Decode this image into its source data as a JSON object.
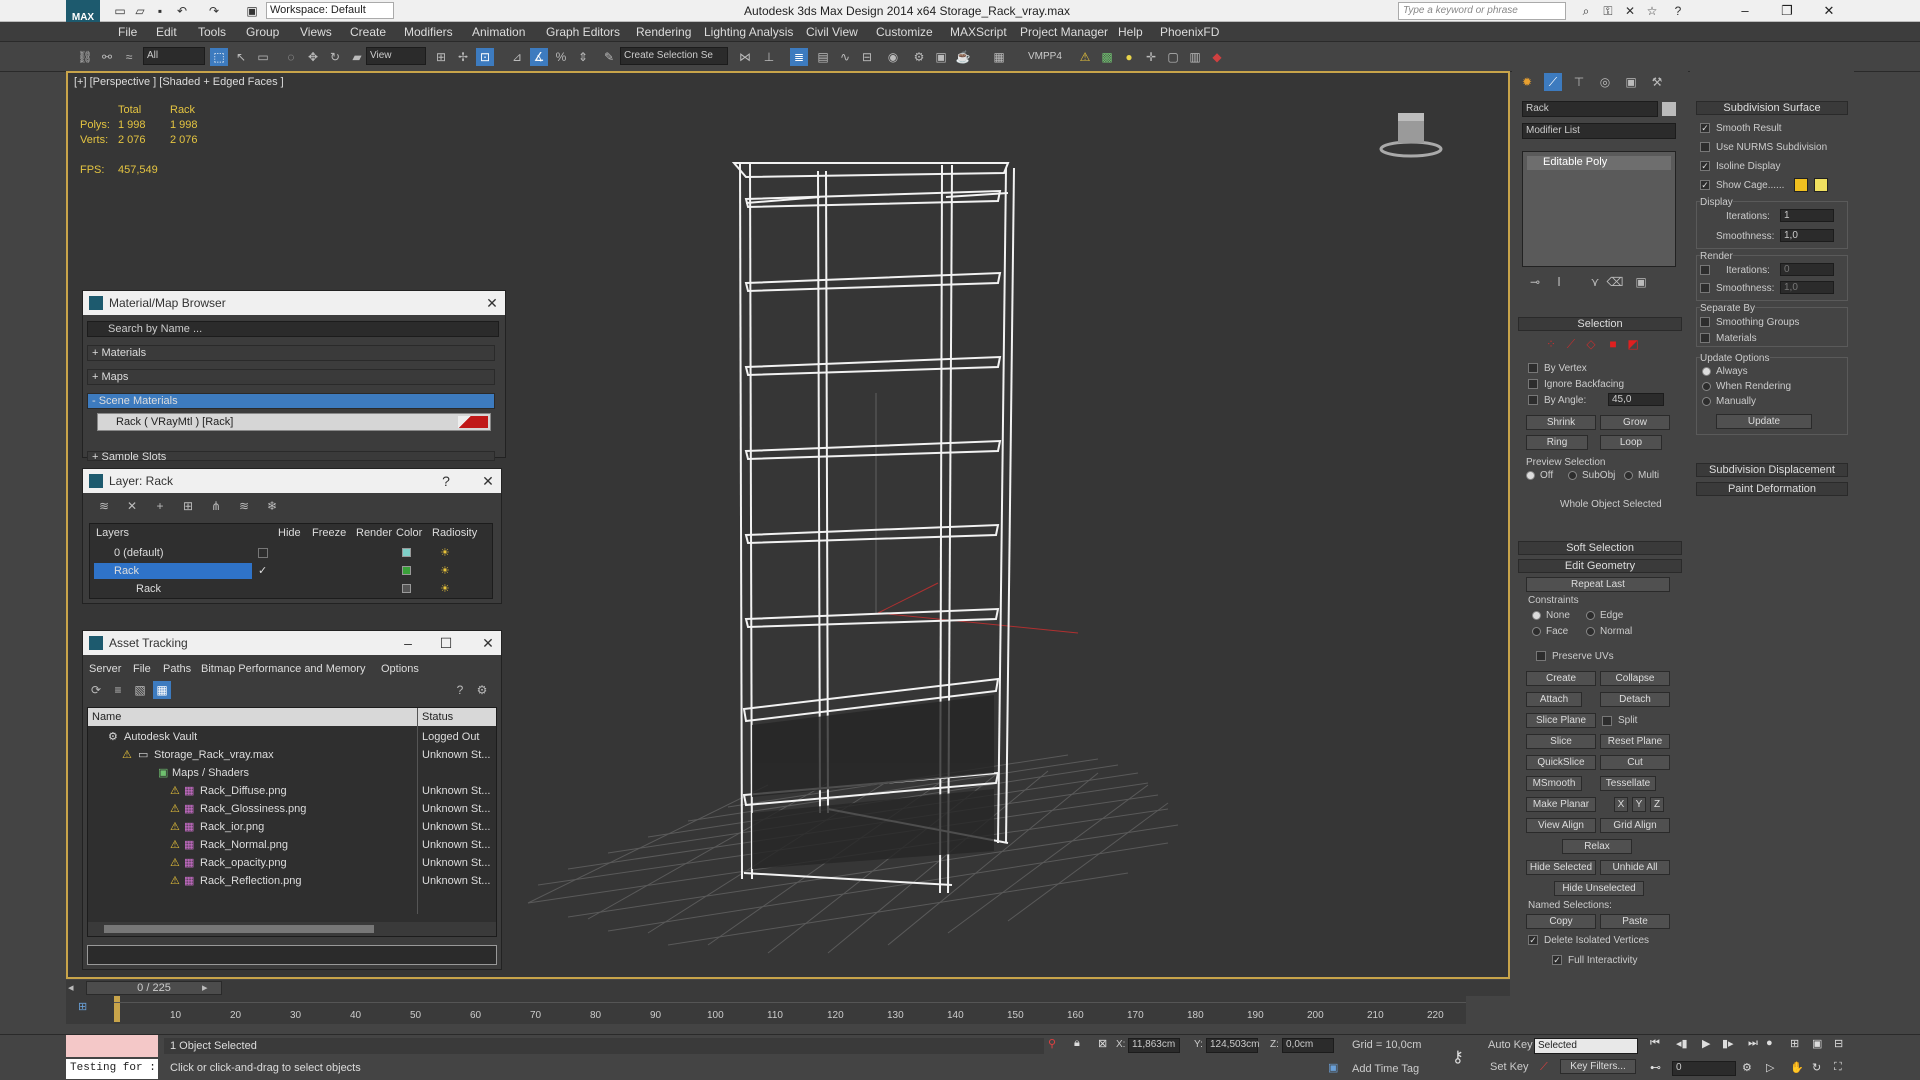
{
  "titlebar": {
    "workspace": "Workspace: Default",
    "title": "Autodesk 3ds Max Design 2014 x64     Storage_Rack_vray.max",
    "search_placeholder": "Type a keyword or phrase",
    "logo": "MAX"
  },
  "menu": [
    "File",
    "Edit",
    "Tools",
    "Group",
    "Views",
    "Create",
    "Modifiers",
    "Animation",
    "Graph Editors",
    "Rendering",
    "Lighting Analysis",
    "Civil View",
    "Customize",
    "MAXScript",
    "Project Manager",
    "Help",
    "PhoenixFD"
  ],
  "toolbar": {
    "filter": "All",
    "refcoord": "View",
    "selection_set": "Create Selection Se",
    "vmpp": "VMPP4"
  },
  "viewport": {
    "label": "[+] [Perspective ] [Shaded + Edged Faces ]",
    "stats": {
      "col_total": "Total",
      "col_rack": "Rack",
      "polys_label": "Polys:",
      "polys_total": "1 998",
      "polys_rack": "1 998",
      "verts_label": "Verts:",
      "verts_total": "2 076",
      "verts_rack": "2 076",
      "fps_label": "FPS:",
      "fps_value": "457,549"
    }
  },
  "material_browser": {
    "title": "Material/Map Browser",
    "search": "Search by Name ...",
    "rollouts": [
      "+ Materials",
      "+ Maps",
      "- Scene Materials"
    ],
    "item": "Rack  ( VRayMtl )  [Rack]",
    "sample_slots": "+ Sample Slots"
  },
  "layer": {
    "title": "Layer: Rack",
    "help": "?",
    "columns": [
      "Layers",
      "Hide",
      "Freeze",
      "Render",
      "Color",
      "Radiosity"
    ],
    "rows": [
      {
        "name": "0 (default)",
        "color": "#7fd0c8"
      },
      {
        "name": "Rack",
        "color": "#3aa03a"
      },
      {
        "name": "Rack",
        "color": "#555555"
      }
    ]
  },
  "asset": {
    "title": "Asset Tracking",
    "menu": [
      "Server",
      "File",
      "Paths",
      "Bitmap Performance and Memory",
      "Options"
    ],
    "columns": [
      "Name",
      "Status"
    ],
    "rows": [
      {
        "name": "Autodesk Vault",
        "status": "Logged Out"
      },
      {
        "name": "Storage_Rack_vray.max",
        "status": "Unknown St..."
      },
      {
        "name": "Maps / Shaders",
        "status": ""
      },
      {
        "name": "Rack_Diffuse.png",
        "status": "Unknown St..."
      },
      {
        "name": "Rack_Glossiness.png",
        "status": "Unknown St..."
      },
      {
        "name": "Rack_ior.png",
        "status": "Unknown St..."
      },
      {
        "name": "Rack_Normal.png",
        "status": "Unknown St..."
      },
      {
        "name": "Rack_opacity.png",
        "status": "Unknown St..."
      },
      {
        "name": "Rack_Reflection.png",
        "status": "Unknown St..."
      }
    ]
  },
  "command": {
    "object_name": "Rack",
    "modifier_list": "Modifier List",
    "stack_item": "Editable Poly",
    "selection": {
      "title": "Selection",
      "by_vertex": "By Vertex",
      "ignore_backfacing": "Ignore Backfacing",
      "by_angle": "By Angle:",
      "angle_value": "45,0",
      "shrink": "Shrink",
      "grow": "Grow",
      "ring": "Ring",
      "loop": "Loop",
      "preview": "Preview Selection",
      "off": "Off",
      "subobj": "SubObj",
      "multi": "Multi",
      "whole": "Whole Object Selected"
    },
    "soft_selection": "Soft Selection",
    "edit_geometry": {
      "title": "Edit Geometry",
      "repeat_last": "Repeat Last",
      "constraints": "Constraints",
      "none": "None",
      "edge": "Edge",
      "face": "Face",
      "normal": "Normal",
      "preserve_uvs": "Preserve UVs",
      "create": "Create",
      "collapse": "Collapse",
      "attach": "Attach",
      "detach": "Detach",
      "slice_plane": "Slice Plane",
      "split": "Split",
      "slice": "Slice",
      "reset_plane": "Reset Plane",
      "quickslice": "QuickSlice",
      "cut": "Cut",
      "msmooth": "MSmooth",
      "tessellate": "Tessellate",
      "make_planar": "Make Planar",
      "x": "X",
      "y": "Y",
      "z": "Z",
      "view_align": "View Align",
      "grid_align": "Grid Align",
      "relax": "Relax",
      "hide_selected": "Hide Selected",
      "unhide_all": "Unhide All",
      "hide_unselected": "Hide Unselected",
      "named_selections": "Named Selections:",
      "copy": "Copy",
      "paste": "Paste",
      "delete_isolated": "Delete Isolated Vertices",
      "full_interactivity": "Full Interactivity"
    },
    "subdivision": {
      "title": "Subdivision Surface",
      "smooth_result": "Smooth Result",
      "use_nurms": "Use NURMS Subdivision",
      "isoline": "Isoline Display",
      "show_cage": "Show Cage......",
      "cage_color1": "#f0c020",
      "cage_color2": "#f0e060",
      "display": "Display",
      "iterations": "Iterations:",
      "iter_value": "1",
      "smoothness": "Smoothness:",
      "smooth_value": "1,0",
      "render": "Render",
      "r_iter_value": "0",
      "r_smooth_value": "1,0",
      "separate_by": "Separate By",
      "smoothing_groups": "Smoothing Groups",
      "materials": "Materials",
      "update_options": "Update Options",
      "always": "Always",
      "when_rendering": "When Rendering",
      "manually": "Manually",
      "update": "Update"
    },
    "subdiv_displacement": "Subdivision Displacement",
    "paint_deformation": "Paint Deformation"
  },
  "timeline": {
    "frame": "0 / 225",
    "ticks": [
      "10",
      "20",
      "30",
      "40",
      "50",
      "60",
      "70",
      "80",
      "90",
      "100",
      "110",
      "120",
      "130",
      "140",
      "150",
      "160",
      "170",
      "180",
      "190",
      "200",
      "210",
      "220"
    ]
  },
  "status": {
    "maxscript": "Testing for :",
    "selected": "1 Object Selected",
    "prompt": "Click or click-and-drag to select objects",
    "x_label": "X:",
    "x_value": "11,863cm",
    "y_label": "Y:",
    "y_value": "124,503cm",
    "z_label": "Z:",
    "z_value": "0,0cm",
    "grid": "Grid = 10,0cm",
    "add_time_tag": "Add Time Tag",
    "auto_key": "Auto Key",
    "set_key": "Set Key",
    "selected_combo": "Selected",
    "key_filters": "Key Filters...",
    "frame_value": "0"
  }
}
